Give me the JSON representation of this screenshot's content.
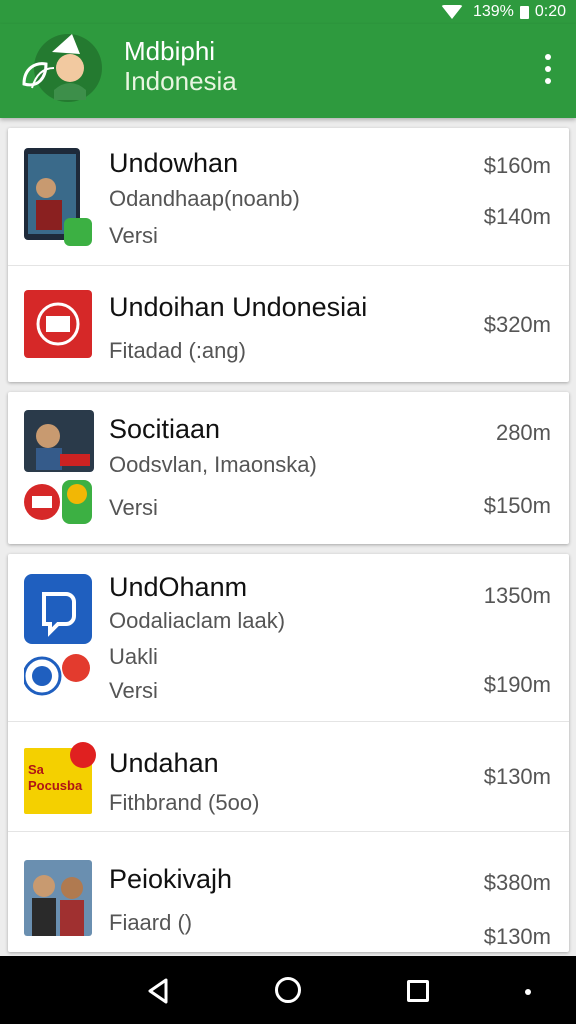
{
  "status_bar": {
    "battery": "139%",
    "time": "0:20"
  },
  "app_bar": {
    "title_line1": "Mdbiphi",
    "title_line2": "Indonesia"
  },
  "cards": [
    {
      "rows": [
        {
          "name": "Undowhan",
          "sub1": "Odandhaap(noanb)",
          "sub2": "Versi",
          "price1": "$160m",
          "price2": "$140m"
        },
        {
          "name": "Undoihan Undonesiai",
          "sub1": "Fitadad (:ang)",
          "price1": "$320m"
        }
      ]
    },
    {
      "rows": [
        {
          "name": "Socitiaan",
          "sub1": "Oodsvlan, Imaonska)",
          "sub2": "Versi",
          "price1": "280m",
          "price2": "$150m"
        }
      ]
    },
    {
      "rows": [
        {
          "name": "UndOhanm",
          "sub1": "Oodaliaclam laak)",
          "sub2": "Uakli",
          "sub3": "Versi",
          "price1": "1350m",
          "price2": "$190m"
        },
        {
          "name": "Undahan",
          "sub1": "Fithbrand (5oo)",
          "price1": "$130m",
          "thumb_text1": "Sa",
          "thumb_text2": "Pocusba"
        },
        {
          "name": "Peiokivajh",
          "sub1": "Fiaard ()",
          "price1": "$380m",
          "price2": "$130m"
        }
      ]
    }
  ],
  "colors": {
    "primary": "#2e9a3e",
    "price_text": "#555555",
    "card_bg": "#ffffff"
  },
  "icons": [
    "wifi-icon",
    "battery-icon",
    "app-logo",
    "overflow-menu-icon",
    "back-icon",
    "home-icon",
    "recents-icon"
  ]
}
